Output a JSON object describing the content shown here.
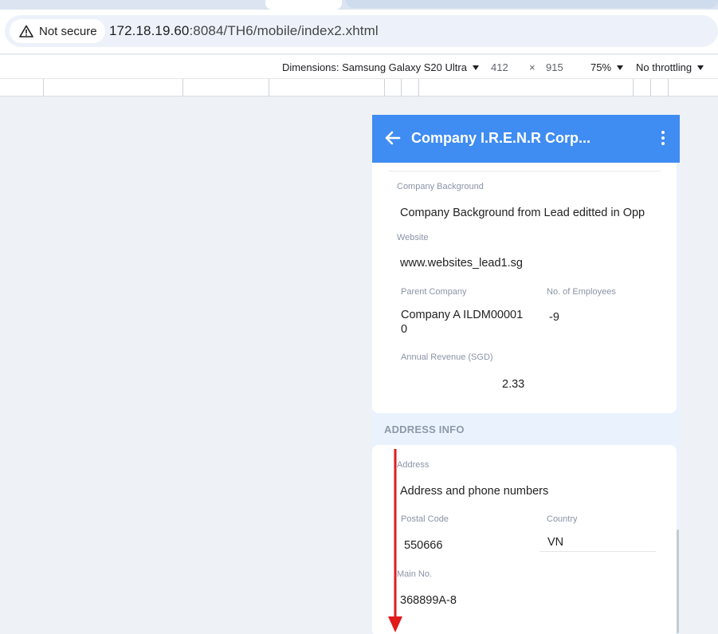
{
  "browser": {
    "security_label": "Not secure",
    "url_host": "172.18.19.60",
    "url_path": ":8084/TH6/mobile/index2.xhtml"
  },
  "device_toolbar": {
    "dimensions_label": "Dimensions: Samsung Galaxy S20 Ultra",
    "width": "412",
    "times": "×",
    "height": "915",
    "zoom": "75%",
    "throttling": "No throttling"
  },
  "app": {
    "title": "Company I.R.E.N.R Corp...",
    "company_info": {
      "company_background_label": "Company Background",
      "company_background_value": "Company Background from Lead editted in Opp",
      "website_label": "Website",
      "website_value": "www.websites_lead1.sg",
      "parent_company_label": "Parent Company",
      "parent_company_value_line1": "Company A ILDM00001",
      "parent_company_value_line2": "0",
      "employees_label": "No. of Employees",
      "employees_value": "-9",
      "annual_revenue_label": "Annual Revenue (SGD)",
      "annual_revenue_value": "2.33"
    },
    "address_section_title": "ADDRESS INFO",
    "address_info": {
      "address_label": "Address",
      "address_value": "Address and phone numbers",
      "postal_code_label": "Postal Code",
      "postal_code_value": "550666",
      "country_label": "Country",
      "country_value": "VN",
      "main_no_label": "Main No.",
      "main_no_value": "368899A-8"
    }
  },
  "colors": {
    "appbar": "#3f8cf2",
    "annotation_arrow": "#e01b1b"
  }
}
